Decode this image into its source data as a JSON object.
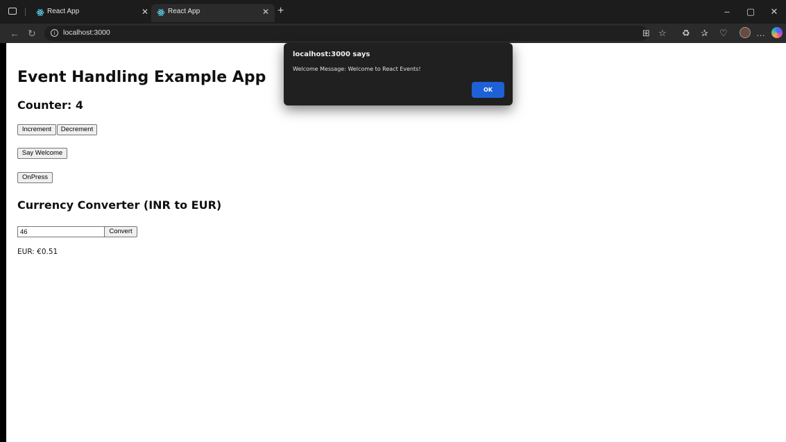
{
  "browser": {
    "tabs": [
      {
        "title": "React App",
        "active": false
      },
      {
        "title": "React App",
        "active": true
      }
    ],
    "url": "localhost:3000",
    "accent_color": "#1e61d6"
  },
  "page": {
    "title": "Event Handling Example App",
    "counter_label": "Counter: 4",
    "increment_label": "Increment",
    "decrement_label": "Decrement",
    "welcome_label": "Say Welcome",
    "onpress_label": "OnPress",
    "currency_title": "Currency Converter (INR to EUR)",
    "inr_value": "46",
    "convert_label": "Convert",
    "eur_result": "EUR: €0.51"
  },
  "dialog": {
    "title": "localhost:3000 says",
    "message": "Welcome Message: Welcome to React Events!",
    "ok_label": "OK"
  }
}
